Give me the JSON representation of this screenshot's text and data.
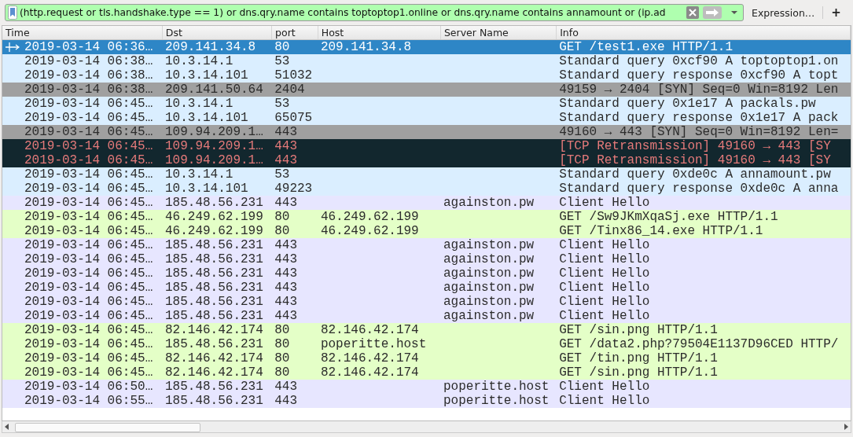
{
  "filter_bar": {
    "value": "(http.request or tls.handshake.type == 1) or dns.qry.name contains toptoptop1.online or dns.qry.name contains annamount or (ip.ad",
    "expression_button": "Expression…",
    "add_button": "+"
  },
  "table": {
    "columns": [
      "Time",
      "Dst",
      "port",
      "Host",
      "Server Name",
      "Info"
    ],
    "rows": [
      {
        "kind": "http",
        "selected": true,
        "related": true,
        "cells": [
          "2019-03-14 06:36…",
          "209.141.34.8",
          "80",
          "209.141.34.8",
          "",
          "GET /test1.exe HTTP/1.1"
        ]
      },
      {
        "kind": "dns",
        "selected": false,
        "related": false,
        "cells": [
          "2019-03-14 06:38…",
          "10.3.14.1",
          "53",
          "",
          "",
          "Standard query 0xcf90 A toptoptop1.on"
        ]
      },
      {
        "kind": "dns",
        "selected": false,
        "related": false,
        "cells": [
          "2019-03-14 06:38…",
          "10.3.14.101",
          "51032",
          "",
          "",
          "Standard query response 0xcf90 A topt"
        ]
      },
      {
        "kind": "tcp",
        "selected": false,
        "related": false,
        "cells": [
          "2019-03-14 06:38…",
          "209.141.50.64",
          "2404",
          "",
          "",
          "49159 → 2404 [SYN] Seq=0 Win=8192 Len"
        ]
      },
      {
        "kind": "dns",
        "selected": false,
        "related": false,
        "cells": [
          "2019-03-14 06:45…",
          "10.3.14.1",
          "53",
          "",
          "",
          "Standard query 0x1e17 A packals.pw"
        ]
      },
      {
        "kind": "dns",
        "selected": false,
        "related": false,
        "cells": [
          "2019-03-14 06:45…",
          "10.3.14.101",
          "65075",
          "",
          "",
          "Standard query response 0x1e17 A pack"
        ]
      },
      {
        "kind": "tcp",
        "selected": false,
        "related": false,
        "cells": [
          "2019-03-14 06:45…",
          "109.94.209.1…",
          "443",
          "",
          "",
          "49160 → 443 [SYN] Seq=0 Win=8192 Len="
        ]
      },
      {
        "kind": "retransmission",
        "selected": false,
        "related": false,
        "cells": [
          "2019-03-14 06:45…",
          "109.94.209.1…",
          "443",
          "",
          "",
          "[TCP Retransmission] 49160 → 443 [SY"
        ]
      },
      {
        "kind": "retransmission",
        "selected": false,
        "related": false,
        "cells": [
          "2019-03-14 06:45…",
          "109.94.209.1…",
          "443",
          "",
          "",
          "[TCP Retransmission] 49160 → 443 [SY"
        ]
      },
      {
        "kind": "dns",
        "selected": false,
        "related": false,
        "cells": [
          "2019-03-14 06:45…",
          "10.3.14.1",
          "53",
          "",
          "",
          "Standard query 0xde0c A annamount.pw"
        ]
      },
      {
        "kind": "dns",
        "selected": false,
        "related": false,
        "cells": [
          "2019-03-14 06:45…",
          "10.3.14.101",
          "49223",
          "",
          "",
          "Standard query response 0xde0c A anna"
        ]
      },
      {
        "kind": "tls",
        "selected": false,
        "related": false,
        "cells": [
          "2019-03-14 06:45…",
          "185.48.56.231",
          "443",
          "",
          "againston.pw",
          "Client Hello"
        ]
      },
      {
        "kind": "http",
        "selected": false,
        "related": false,
        "cells": [
          "2019-03-14 06:45…",
          "46.249.62.199",
          "80",
          "46.249.62.199",
          "",
          "GET /Sw9JKmXqaSj.exe HTTP/1.1"
        ]
      },
      {
        "kind": "http",
        "selected": false,
        "related": false,
        "cells": [
          "2019-03-14 06:45…",
          "46.249.62.199",
          "80",
          "46.249.62.199",
          "",
          "GET /Tinx86_14.exe HTTP/1.1"
        ]
      },
      {
        "kind": "tls",
        "selected": false,
        "related": false,
        "cells": [
          "2019-03-14 06:45…",
          "185.48.56.231",
          "443",
          "",
          "againston.pw",
          "Client Hello"
        ]
      },
      {
        "kind": "tls",
        "selected": false,
        "related": false,
        "cells": [
          "2019-03-14 06:45…",
          "185.48.56.231",
          "443",
          "",
          "againston.pw",
          "Client Hello"
        ]
      },
      {
        "kind": "tls",
        "selected": false,
        "related": false,
        "cells": [
          "2019-03-14 06:45…",
          "185.48.56.231",
          "443",
          "",
          "againston.pw",
          "Client Hello"
        ]
      },
      {
        "kind": "tls",
        "selected": false,
        "related": false,
        "cells": [
          "2019-03-14 06:45…",
          "185.48.56.231",
          "443",
          "",
          "againston.pw",
          "Client Hello"
        ]
      },
      {
        "kind": "tls",
        "selected": false,
        "related": false,
        "cells": [
          "2019-03-14 06:45…",
          "185.48.56.231",
          "443",
          "",
          "againston.pw",
          "Client Hello"
        ]
      },
      {
        "kind": "tls",
        "selected": false,
        "related": false,
        "cells": [
          "2019-03-14 06:45…",
          "185.48.56.231",
          "443",
          "",
          "againston.pw",
          "Client Hello"
        ]
      },
      {
        "kind": "http",
        "selected": false,
        "related": false,
        "cells": [
          "2019-03-14 06:45…",
          "82.146.42.174",
          "80",
          "82.146.42.174",
          "",
          "GET /sin.png HTTP/1.1"
        ]
      },
      {
        "kind": "http",
        "selected": false,
        "related": false,
        "cells": [
          "2019-03-14 06:45…",
          "185.48.56.231",
          "80",
          "poperitte.host",
          "",
          "GET /data2.php?79504E1137D96CED HTTP/"
        ]
      },
      {
        "kind": "http",
        "selected": false,
        "related": false,
        "cells": [
          "2019-03-14 06:45…",
          "82.146.42.174",
          "80",
          "82.146.42.174",
          "",
          "GET /tin.png HTTP/1.1"
        ]
      },
      {
        "kind": "http",
        "selected": false,
        "related": false,
        "cells": [
          "2019-03-14 06:45…",
          "82.146.42.174",
          "80",
          "82.146.42.174",
          "",
          "GET /sin.png HTTP/1.1"
        ]
      },
      {
        "kind": "tls",
        "selected": false,
        "related": false,
        "cells": [
          "2019-03-14 06:50…",
          "185.48.56.231",
          "443",
          "",
          "poperitte.host",
          "Client Hello"
        ]
      },
      {
        "kind": "tls",
        "selected": false,
        "related": false,
        "cells": [
          "2019-03-14 06:55…",
          "185.48.56.231",
          "443",
          "",
          "poperitte.host",
          "Client Hello"
        ]
      }
    ]
  }
}
